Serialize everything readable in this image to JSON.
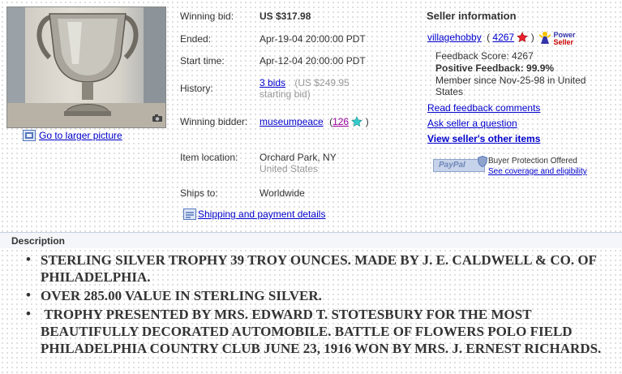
{
  "photo": {
    "larger_link": "Go to larger picture"
  },
  "details": {
    "winning_bid": {
      "label": "Winning bid:",
      "value": "US $317.98"
    },
    "ended": {
      "label": "Ended:",
      "value": "Apr-19-04 20:00:00 PDT"
    },
    "start_time": {
      "label": "Start time:",
      "value": "Apr-12-04 20:00:00 PDT"
    },
    "history": {
      "label": "History:",
      "bids_link": "3 bids",
      "note_line1": "(US $249.95",
      "note_line2": "starting bid)"
    },
    "winning_bidder": {
      "label": "Winning bidder:",
      "name": "museumpeace",
      "open": "(",
      "score": "126",
      "close": ")"
    },
    "item_location": {
      "label": "Item location:",
      "city": "Orchard Park, NY",
      "country": "United States"
    },
    "ships_to": {
      "label": "Ships to:",
      "value": "Worldwide"
    },
    "shipping_link": "Shipping and payment details"
  },
  "seller": {
    "heading": "Seller information",
    "name": "villagehobby",
    "open": "(",
    "score": "4267",
    "close": ")",
    "power_seller_line1": "Power",
    "power_seller_line2": "Seller",
    "feedback_score": "Feedback Score: 4267",
    "positive_feedback": "Positive Feedback: 99.9%",
    "member_since_line1": "Member since Nov-25-98 in United",
    "member_since_line2": "States",
    "links": {
      "read_feedback": "Read feedback comments",
      "ask_question": "Ask seller a question",
      "other_items": "View seller's other items"
    }
  },
  "buyer_protection": {
    "badge_text": "PayPal",
    "title": "Buyer Protection Offered",
    "link": "See coverage and eligibility"
  },
  "description": {
    "heading": "Description",
    "bullet": "•",
    "items": [
      "STERLING SILVER TROPHY 39 TROY OUNCES. MADE BY J. E. CALDWELL & CO. OF PHILADELPHIA.",
      "OVER 285.00 VALUE IN STERLING SILVER.",
      " TROPHY PRESENTED BY MRS. EDWARD T. STOTESBURY FOR THE MOST BEAUTIFULLY DECORATED AUTOMOBILE. BATTLE OF FLOWERS POLO FIELD PHILADELPHIA COUNTRY CLUB JUNE 23, 1916 WON BY MRS. J. ERNEST RICHARDS."
    ]
  },
  "colors": {
    "link": "#0000cc",
    "feedback_purple": "#990099",
    "star_red": "#e8202a",
    "star_turquoise": "#33cccc",
    "power_seller_blue": "#3333aa",
    "power_seller_red": "#cc0000"
  }
}
